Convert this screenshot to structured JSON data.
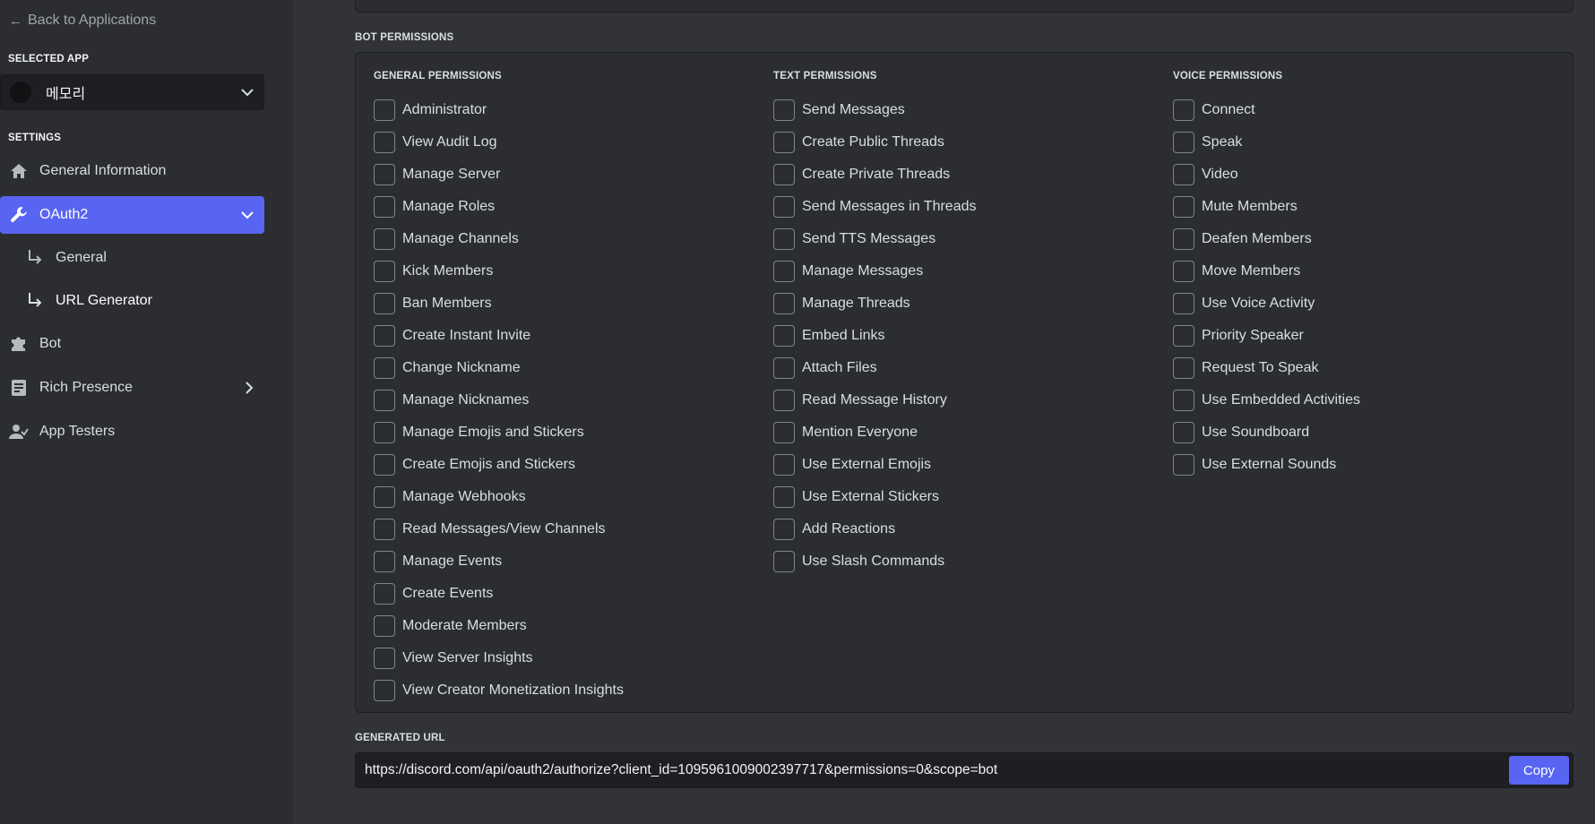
{
  "sidebar": {
    "back_label": "Back to Applications",
    "selected_app_heading": "SELECTED APP",
    "app_name": "메모리",
    "settings_heading": "SETTINGS",
    "items": [
      {
        "label": "General Information",
        "icon": "home-icon"
      },
      {
        "label": "OAuth2",
        "icon": "wrench-icon"
      },
      {
        "label": "Bot",
        "icon": "puzzle-icon"
      },
      {
        "label": "Rich Presence",
        "icon": "document-icon"
      },
      {
        "label": "App Testers",
        "icon": "user-check-icon"
      }
    ],
    "oauth_subitems": [
      {
        "label": "General"
      },
      {
        "label": "URL Generator"
      }
    ]
  },
  "main": {
    "bot_permissions_heading": "BOT PERMISSIONS",
    "columns": {
      "general": {
        "title": "GENERAL PERMISSIONS",
        "items": [
          "Administrator",
          "View Audit Log",
          "Manage Server",
          "Manage Roles",
          "Manage Channels",
          "Kick Members",
          "Ban Members",
          "Create Instant Invite",
          "Change Nickname",
          "Manage Nicknames",
          "Manage Emojis and Stickers",
          "Create Emojis and Stickers",
          "Manage Webhooks",
          "Read Messages/View Channels",
          "Manage Events",
          "Create Events",
          "Moderate Members",
          "View Server Insights",
          "View Creator Monetization Insights"
        ]
      },
      "text": {
        "title": "TEXT PERMISSIONS",
        "items": [
          "Send Messages",
          "Create Public Threads",
          "Create Private Threads",
          "Send Messages in Threads",
          "Send TTS Messages",
          "Manage Messages",
          "Manage Threads",
          "Embed Links",
          "Attach Files",
          "Read Message History",
          "Mention Everyone",
          "Use External Emojis",
          "Use External Stickers",
          "Add Reactions",
          "Use Slash Commands"
        ]
      },
      "voice": {
        "title": "VOICE PERMISSIONS",
        "items": [
          "Connect",
          "Speak",
          "Video",
          "Mute Members",
          "Deafen Members",
          "Move Members",
          "Use Voice Activity",
          "Priority Speaker",
          "Request To Speak",
          "Use Embedded Activities",
          "Use Soundboard",
          "Use External Sounds"
        ]
      }
    },
    "generated_url_heading": "GENERATED URL",
    "generated_url": "https://discord.com/api/oauth2/authorize?client_id=1095961009002397717&permissions=0&scope=bot",
    "copy_label": "Copy"
  },
  "colors": {
    "accent": "#5865f2",
    "sidebar_bg": "#2b2d31",
    "main_bg": "#313338"
  }
}
